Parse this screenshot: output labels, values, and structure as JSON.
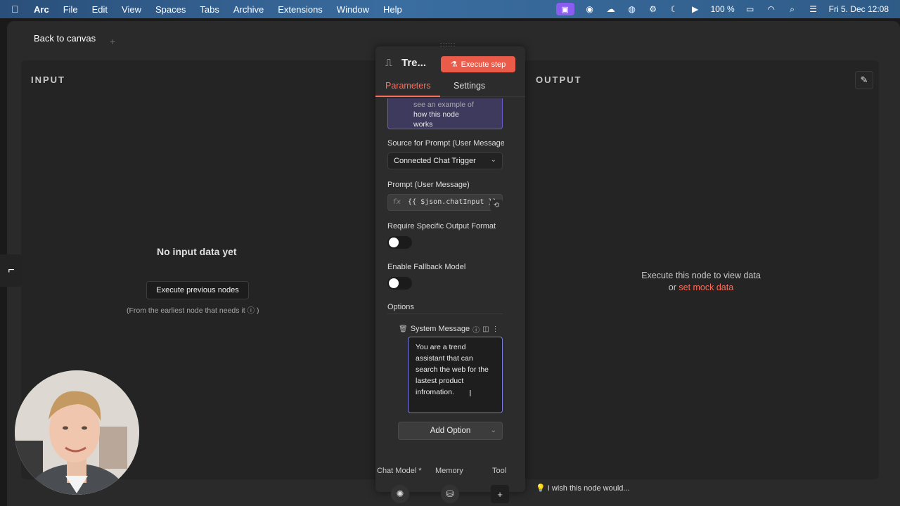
{
  "menubar": {
    "app": "Arc",
    "items": [
      "File",
      "Edit",
      "View",
      "Spaces",
      "Tabs",
      "Archive",
      "Extensions",
      "Window",
      "Help"
    ],
    "battery": "100 %",
    "datetime": "Fri 5. Dec  12:08",
    "icons": [
      "apple-icon",
      "screen-record-icon",
      "app-icon",
      "cloud-icon",
      "globe-icon",
      "gear-icon",
      "moon-icon",
      "play-icon",
      "battery-icon",
      "wifi-icon",
      "search-icon",
      "control-center-icon"
    ]
  },
  "window": {
    "back_label": "Back to canvas",
    "new_tab": "+"
  },
  "ndv": {
    "input_title": "INPUT",
    "output_title": "OUTPUT",
    "no_input": "No input data yet",
    "exec_prev": "Execute previous nodes",
    "input_hint": "(From the earliest node that needs it ⓘ )",
    "output_line1": "Execute this node to view data",
    "output_or": "or ",
    "output_link": "set mock data"
  },
  "node": {
    "title": "Tre...",
    "execute_label": "Execute step",
    "tabs": [
      "Parameters",
      "Settings"
    ],
    "notice_line1": "see an example of",
    "notice_line2": "how this node",
    "notice_line3": "works",
    "source_label": "Source for Prompt (User Message)",
    "source_value": "Connected Chat Trigger",
    "prompt_label": "Prompt (User Message)",
    "prompt_fx": "fx",
    "prompt_value": "{{ $json.chatInput }}",
    "require_format_label": "Require Specific Output Format",
    "fallback_label": "Enable Fallback Model",
    "options_label": "Options",
    "system_message_label": "System Message",
    "system_message_value": "You are a trend assistant that can search the web for the lastest product infromation.",
    "add_option": "Add Option",
    "connectors": [
      "Chat Model *",
      "Memory",
      "Tool"
    ],
    "wish": "I wish this node would..."
  },
  "colors": {
    "accent": "#ff6d5a",
    "execute_bg": "#ea5b4a",
    "notice_bg": "#3e3a5e"
  }
}
